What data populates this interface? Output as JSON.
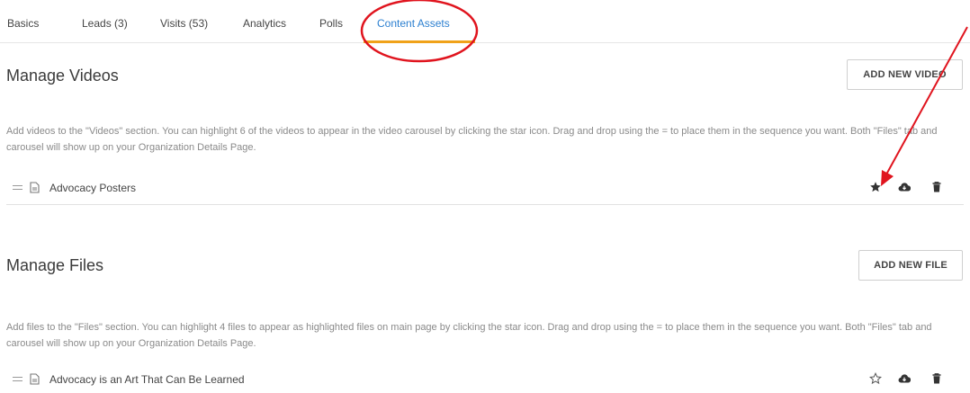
{
  "tabs": [
    {
      "label": "Basics",
      "active": false
    },
    {
      "label": "Leads (3)",
      "active": false
    },
    {
      "label": "Visits (53)",
      "active": false
    },
    {
      "label": "Analytics",
      "active": false
    },
    {
      "label": "Polls",
      "active": false
    },
    {
      "label": "Content Assets",
      "active": true
    }
  ],
  "videos": {
    "title": "Manage Videos",
    "add_button": "ADD NEW VIDEO",
    "description": "Add videos to the \"Videos\" section. You can highlight 6 of the videos to appear in the video carousel by clicking the star icon. Drag and drop using the = to place them in the sequence you want. Both \"Files\" tab and carousel will show up on your Organization Details Page.",
    "items": [
      {
        "label": "Advocacy Posters",
        "starred": true
      }
    ]
  },
  "files": {
    "title": "Manage Files",
    "add_button": "ADD NEW FILE",
    "description": "Add files to the \"Files\" section. You can highlight 4 files to appear as highlighted files on main page by clicking the star icon. Drag and drop using the = to place them in the sequence you want. Both \"Files\" tab and carousel will show up on your Organization Details Page.",
    "items": [
      {
        "label": "Advocacy is an Art That Can Be Learned",
        "starred": false
      }
    ]
  },
  "colors": {
    "active_tab": "#2b7fd0",
    "tab_underline": "#f0a21a",
    "annotation": "#e0141e"
  },
  "icons": [
    "star-filled-icon",
    "star-outline-icon",
    "cloud-download-icon",
    "trash-icon",
    "file-icon",
    "drag-handle-icon"
  ]
}
